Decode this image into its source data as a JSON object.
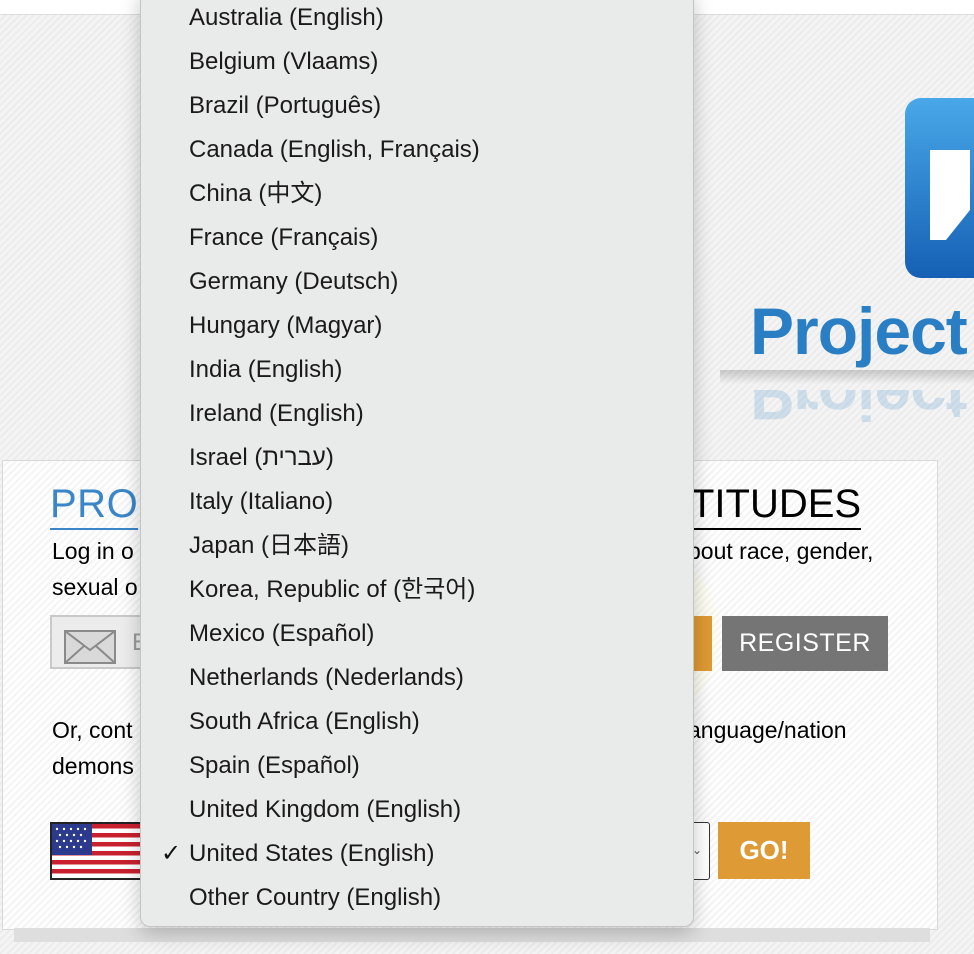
{
  "page": {
    "logo_text": "Project",
    "panel_title_left": "PRO",
    "panel_title_right": "TITUDES",
    "desc_line1_left": "Log in o",
    "desc_line1_right": "bout race, gender,",
    "desc_line2_left": "sexual o",
    "email_placeholder": "E",
    "register_label": "REGISTER",
    "or_line1_left": "Or, cont",
    "or_line1_right": "anguage/nation",
    "or_line2_left": "demons",
    "go_label": "GO!"
  },
  "country_dropdown": {
    "selected": "United States (English)",
    "options": [
      {
        "label": "Australia (English)",
        "checked": false
      },
      {
        "label": "Belgium (Vlaams)",
        "checked": false
      },
      {
        "label": "Brazil (Português)",
        "checked": false
      },
      {
        "label": "Canada (English, Français)",
        "checked": false
      },
      {
        "label": "China (中文)",
        "checked": false
      },
      {
        "label": "France (Français)",
        "checked": false
      },
      {
        "label": "Germany (Deutsch)",
        "checked": false
      },
      {
        "label": "Hungary (Magyar)",
        "checked": false
      },
      {
        "label": "India (English)",
        "checked": false
      },
      {
        "label": "Ireland (English)",
        "checked": false
      },
      {
        "label": "Israel (עברית)",
        "checked": false
      },
      {
        "label": "Italy (Italiano)",
        "checked": false
      },
      {
        "label": "Japan (日本語)",
        "checked": false
      },
      {
        "label": "Korea, Republic of (한국어)",
        "checked": false
      },
      {
        "label": "Mexico (Español)",
        "checked": false
      },
      {
        "label": "Netherlands (Nederlands)",
        "checked": false
      },
      {
        "label": "South Africa (English)",
        "checked": false
      },
      {
        "label": "Spain (Español)",
        "checked": false
      },
      {
        "label": "United Kingdom (English)",
        "checked": false
      },
      {
        "label": "United States (English)",
        "checked": true
      },
      {
        "label": "Other Country (English)",
        "checked": false
      }
    ],
    "check_glyph": "✓"
  },
  "icons": {
    "mail": "mail-icon",
    "flag": "us-flag-icon",
    "check": "checkmark-icon"
  },
  "colors": {
    "accent_blue": "#3a86c8",
    "go_orange": "#de9a34",
    "register_gray": "#757575",
    "dropdown_bg": "#e8ebe9"
  }
}
